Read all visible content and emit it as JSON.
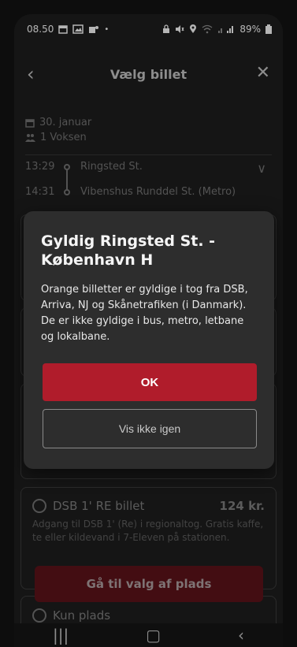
{
  "status_bar": {
    "time": "08.50",
    "left_icons": [
      "calendar-icon",
      "photo-icon",
      "teams-icon",
      "dot-icon"
    ],
    "right_icons": [
      "lock-icon",
      "mute-icon",
      "location-icon",
      "wifi-icon",
      "signal-icon"
    ],
    "battery": "89%"
  },
  "header": {
    "title": "Vælg billet"
  },
  "trip": {
    "date": "30. januar",
    "passengers": "1 Voksen",
    "departure_time": "13:29",
    "departure_station": "Ringsted St.",
    "arrival_time": "14:31",
    "arrival_station": "Vibenshus Runddel St. (Metro)"
  },
  "option": {
    "title": "DSB 1' RE billet",
    "price": "124 kr.",
    "description": "Adgang til DSB 1' (Re) i regionaltog. Gratis kaffe, te eller kildevand i 7-Eleven på stationen."
  },
  "cta": {
    "label": "Gå til valg af plads"
  },
  "option2": {
    "title": "Kun plads"
  },
  "dialog": {
    "title": "Gyldig Ringsted St. - København H",
    "body": "Orange billetter er gyldige i tog fra DSB, Arriva, NJ og Skånetrafiken (i Danmark). De er ikke gyldige i bus, metro, letbane og lokalbane.",
    "ok_label": "OK",
    "secondary_label": "Vis ikke igen"
  },
  "colors": {
    "accent": "#b01c2b",
    "background": "#1d1d1d",
    "dialog": "#2d2d2d"
  }
}
